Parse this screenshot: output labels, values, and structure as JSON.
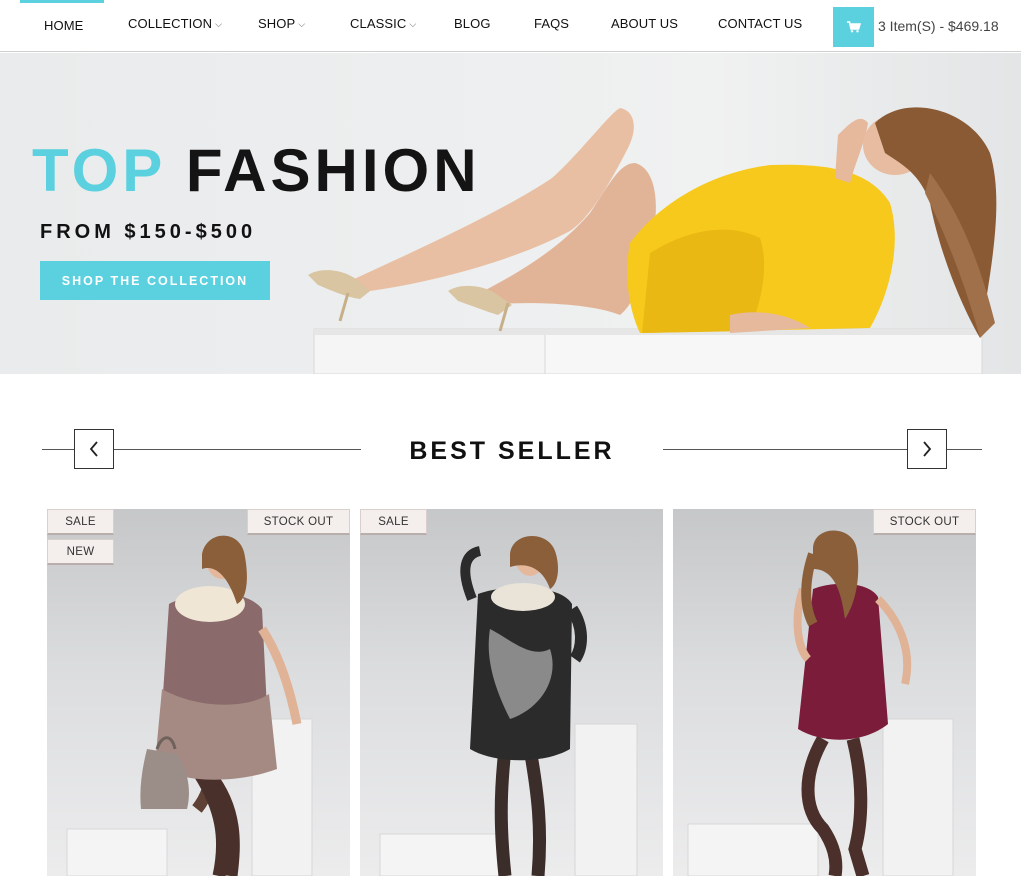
{
  "nav": {
    "items": [
      {
        "label": "HOME",
        "dropdown": false,
        "active": true
      },
      {
        "label": "COLLECTION",
        "dropdown": true
      },
      {
        "label": "SHOP",
        "dropdown": true
      },
      {
        "label": "CLASSIC",
        "dropdown": true
      },
      {
        "label": "BLOG",
        "dropdown": false
      },
      {
        "label": "FAQS",
        "dropdown": false
      },
      {
        "label": "ABOUT US",
        "dropdown": false
      },
      {
        "label": "CONTACT US",
        "dropdown": false
      }
    ],
    "cart": {
      "icon": "cart-icon",
      "summary": "3 Item(S) - $469.18"
    }
  },
  "hero": {
    "title_accent": "TOP",
    "title_main": "FASHION",
    "subtitle": "FROM $150-$500",
    "cta_label": "SHOP THE COLLECTION"
  },
  "best_seller": {
    "title": "BEST SELLER",
    "prev_icon": "chevron-left-icon",
    "next_icon": "chevron-right-icon",
    "products": [
      {
        "badges_left": [
          "SALE",
          "NEW"
        ],
        "badge_right": "STOCK OUT"
      },
      {
        "badges_left": [
          "SALE"
        ],
        "badge_right": ""
      },
      {
        "badges_left": [],
        "badge_right": "STOCK OUT"
      }
    ]
  },
  "colors": {
    "accent": "#5bd0df",
    "dress_yellow": "#f6c91c",
    "dress_maroon": "#7a1c3a"
  }
}
